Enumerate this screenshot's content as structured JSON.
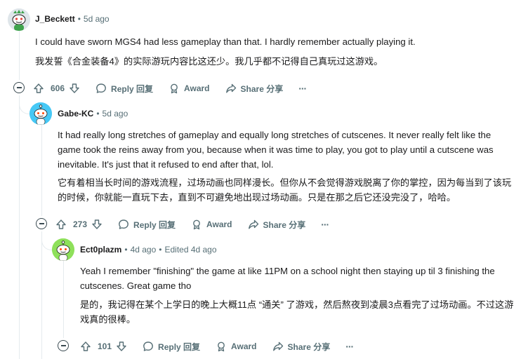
{
  "comments": [
    {
      "username": "J_Beckett",
      "time": "5d ago",
      "edited": "",
      "text_en": "I could have sworn MGS4 had less gameplay than that. I hardly remember actually playing it.",
      "text_zh": "我发誓《合金装备4》的实际游玩内容比这还少。我几乎都不记得自己真玩过这游戏。",
      "votes": "606",
      "reply": "Reply 回复",
      "award": "Award",
      "share": "Share 分享",
      "more": "···"
    },
    {
      "username": "Gabe-KC",
      "time": "5d ago",
      "edited": "",
      "text_en": "It had really long stretches of gameplay and equally long stretches of cutscenes. It never really felt like the game took the reins away from you, because when it was time to play, you got to play until a cutscene was inevitable. It's just that it refused to end after that, lol.",
      "text_zh": "它有着相当长时间的游戏流程，过场动画也同样漫长。但你从不会觉得游戏脱离了你的掌控，因为每当到了该玩的时候，你就能一直玩下去，直到不可避免地出现过场动画。只是在那之后它还没完没了，哈哈。",
      "votes": "273",
      "reply": "Reply 回复",
      "award": "Award",
      "share": "Share 分享",
      "more": "···"
    },
    {
      "username": "Ect0plazm",
      "time": "4d ago",
      "edited": "Edited 4d ago",
      "text_en": "Yeah I remember \"finishing\" the game at like 11PM on a school night then staying up til 3 finishing the cutscenes. Great game tho",
      "text_zh": "是的，我记得在某个上学日的晚上大概11点 “通关” 了游戏，然后熬夜到凌晨3点看完了过场动画。不过这游戏真的很棒。",
      "votes": "101",
      "reply": "Reply 回复",
      "award": "Award",
      "share": "Share 分享",
      "more": "···"
    }
  ],
  "colors": {
    "meta": "#576f76",
    "thread_line": "#e5ebee",
    "avatar1_bg": "#dfe6ea",
    "avatar2_bg": "#46c8f5",
    "avatar3_bg": "#8ee05a"
  },
  "icons": [
    "collapse-icon",
    "upvote-icon",
    "downvote-icon",
    "comment-icon",
    "award-icon",
    "share-icon",
    "more-icon",
    "snoo-avatar-icon"
  ]
}
